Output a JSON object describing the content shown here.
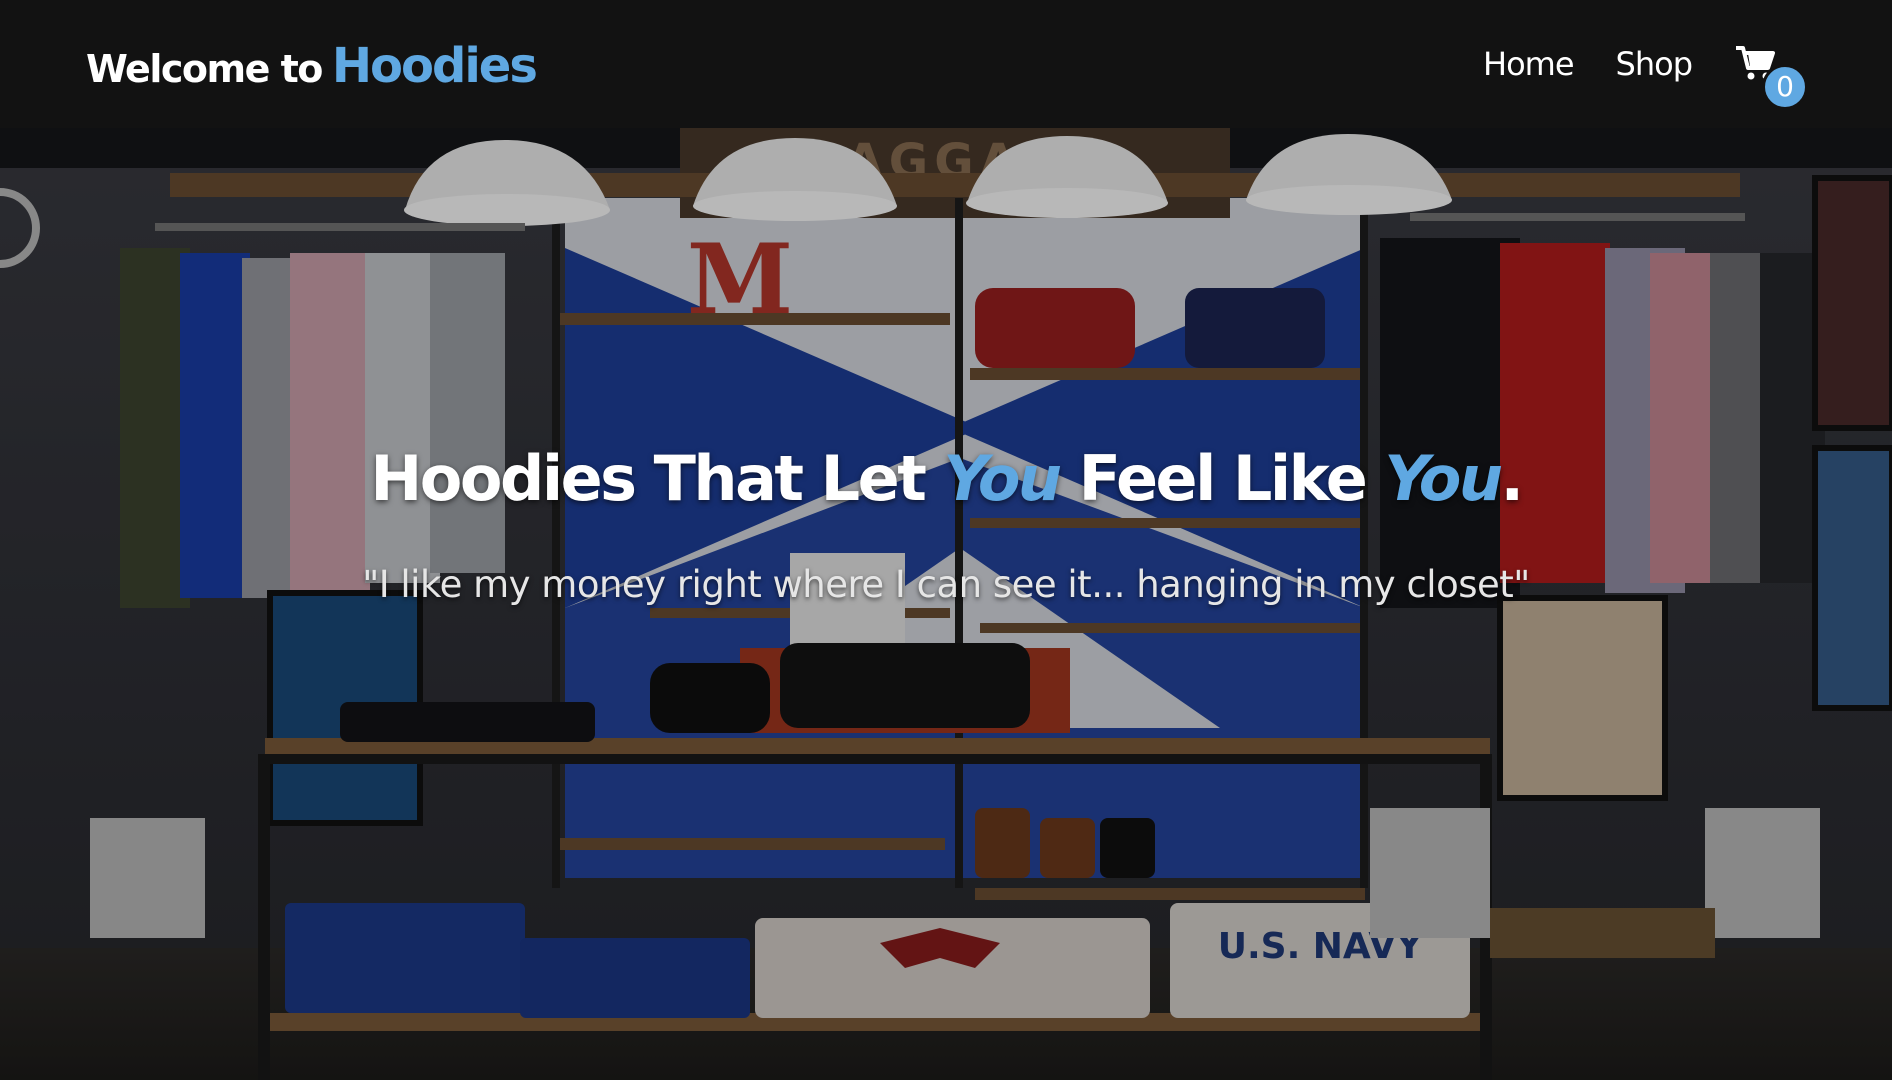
{
  "brand": {
    "prefix": "Welcome to",
    "name": "Hoodies"
  },
  "nav": {
    "links": [
      "Home",
      "Shop"
    ],
    "cart_icon": "shopping-cart-icon",
    "cart_count": "0"
  },
  "hero": {
    "title_part1": "Hoodies That Let ",
    "title_you1": "You",
    "title_part2": " Feel Like ",
    "title_you2": "You",
    "title_end": ".",
    "quote": "\"I like my money right where I can see it... hanging in my closet\"",
    "background_sign_text": "BAGGAGE",
    "crate_text": "U.S. NAVY"
  },
  "colors": {
    "accent": "#5fa8e2",
    "navbar_bg": "#121212"
  }
}
